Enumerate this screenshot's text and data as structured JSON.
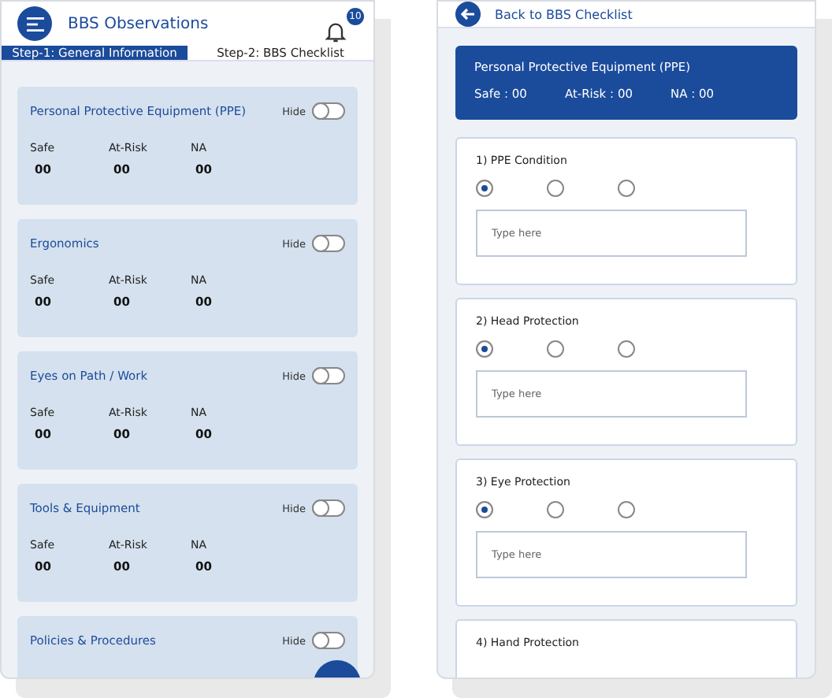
{
  "left_screen": {
    "title": "BBS Observations",
    "notification_count": "10",
    "tabs": [
      {
        "label": "Step-1: General Information",
        "selected": true
      },
      {
        "label": "Step-2: BBS Checklist",
        "selected": false
      }
    ],
    "categories": [
      {
        "name": "Personal Protective Equipment (PPE)",
        "toggle_label": "Hide",
        "on": false,
        "stats": [
          {
            "label": "Safe",
            "value": "00"
          },
          {
            "label": "At-Risk",
            "value": "00"
          },
          {
            "label": "NA",
            "value": "00"
          }
        ]
      },
      {
        "name": "Ergonomics",
        "toggle_label": "Hide",
        "on": false,
        "stats": [
          {
            "label": "Safe",
            "value": "00"
          },
          {
            "label": "At-Risk",
            "value": "00"
          },
          {
            "label": "NA",
            "value": "00"
          }
        ]
      },
      {
        "name": "Eyes on Path / Work",
        "toggle_label": "Hide",
        "on": false,
        "stats": [
          {
            "label": "Safe",
            "value": "00"
          },
          {
            "label": "At-Risk",
            "value": "00"
          },
          {
            "label": "NA",
            "value": "00"
          }
        ]
      },
      {
        "name": "Tools & Equipment",
        "toggle_label": "Hide",
        "on": false,
        "stats": [
          {
            "label": "Safe",
            "value": "00"
          },
          {
            "label": "At-Risk",
            "value": "00"
          },
          {
            "label": "NA",
            "value": "00"
          }
        ]
      },
      {
        "name": "Policies & Procedures",
        "toggle_label": "Hide",
        "on": false
      }
    ]
  },
  "right_screen": {
    "back_label": "Back to BBS Checklist",
    "banner": {
      "title": "Personal Protective Equipment (PPE)",
      "stats": [
        "Safe : 00",
        "At-Risk : 00",
        "NA : 00"
      ]
    },
    "questions": [
      {
        "label": "1) PPE Condition",
        "options": [
          {
            "selected": true
          },
          {
            "selected": false
          },
          {
            "selected": false
          }
        ],
        "placeholder": "Type here"
      },
      {
        "label": "2) Head Protection",
        "options": [
          {
            "selected": true
          },
          {
            "selected": false
          },
          {
            "selected": false
          }
        ],
        "placeholder": "Type here"
      },
      {
        "label": "3) Eye Protection",
        "options": [
          {
            "selected": true
          },
          {
            "selected": false
          },
          {
            "selected": false
          }
        ],
        "placeholder": "Type here"
      },
      {
        "label": "4) Hand Protection"
      }
    ]
  }
}
